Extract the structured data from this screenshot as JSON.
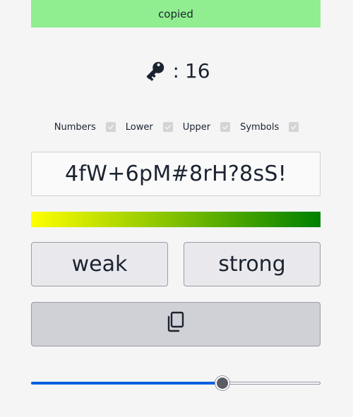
{
  "toast": {
    "text": "copied",
    "color": "#90ee90"
  },
  "length": {
    "icon": "key-icon",
    "separator": ":",
    "value": "16"
  },
  "options": [
    {
      "label": "Numbers",
      "checked": true
    },
    {
      "label": "Lower",
      "checked": true
    },
    {
      "label": "Upper",
      "checked": true
    },
    {
      "label": "Symbols",
      "checked": true
    }
  ],
  "password": {
    "value": "4fW+6pM#8rH?8sS!"
  },
  "strength_bar": {
    "level": 1.0,
    "gradient_start": "#ffff00",
    "gradient_end": "#008000"
  },
  "buttons": {
    "weak_label": "weak",
    "strong_label": "strong",
    "copy_icon": "copy-icon"
  },
  "length_slider": {
    "fraction": 0.66,
    "accent": "#0060df"
  }
}
